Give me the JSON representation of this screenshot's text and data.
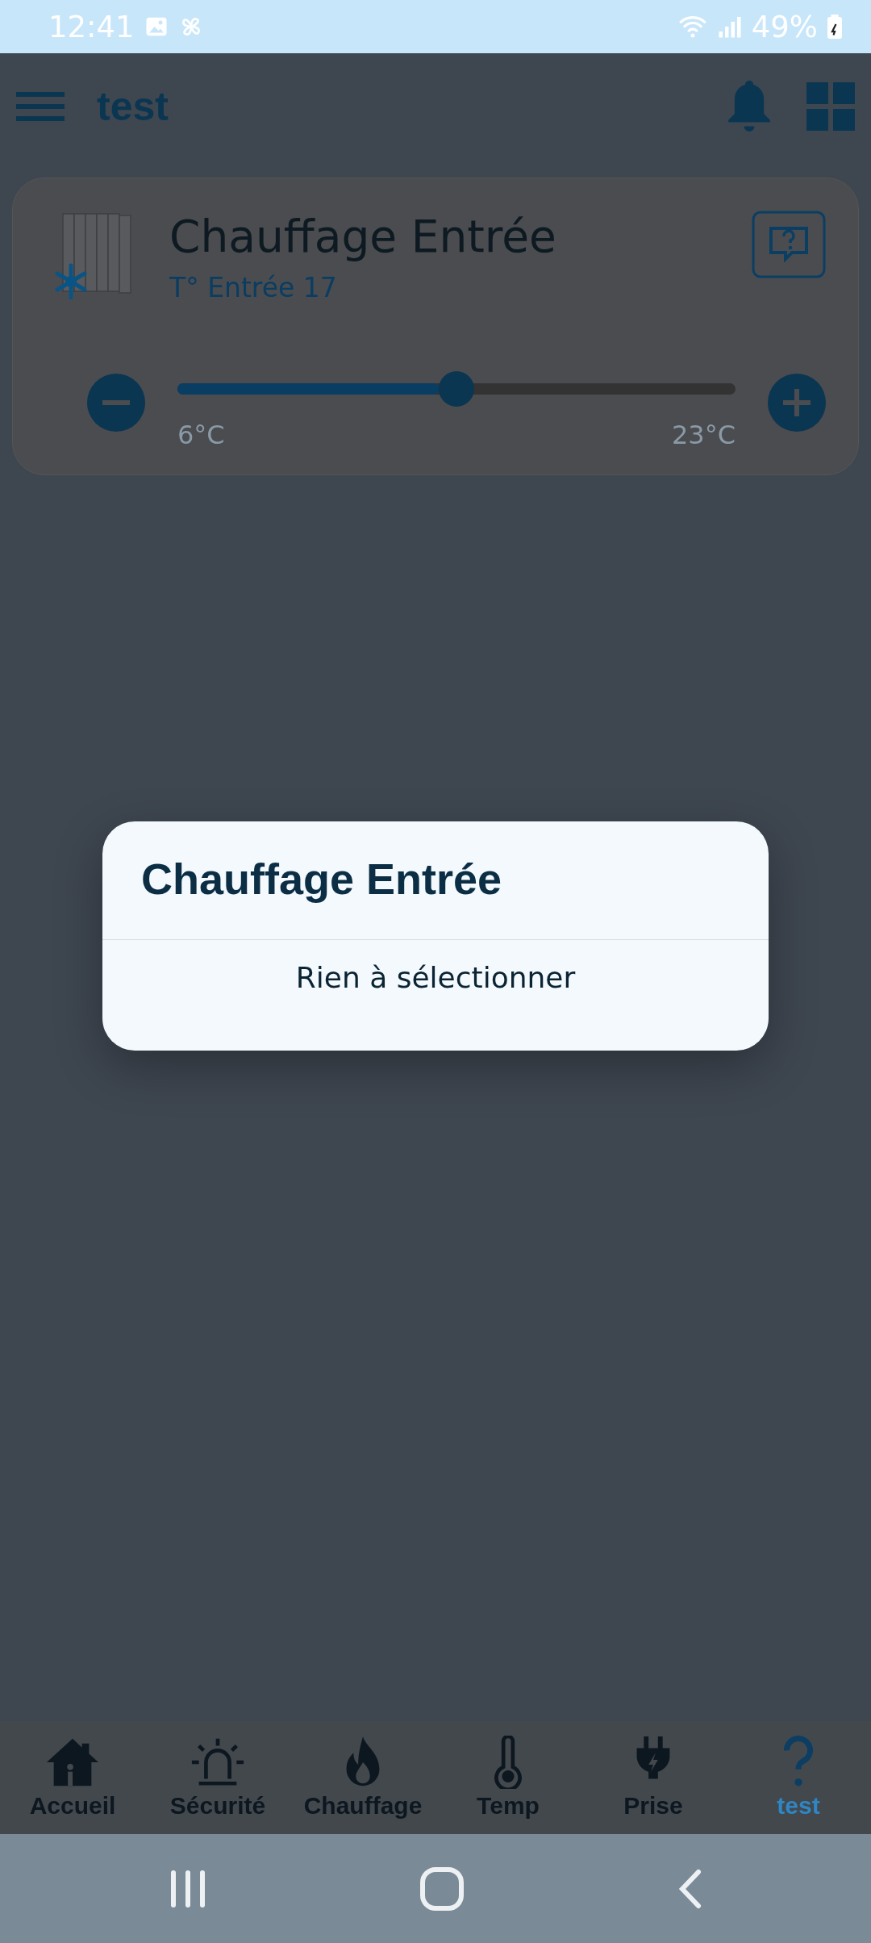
{
  "status_bar": {
    "time": "12:41",
    "battery": "49%"
  },
  "header": {
    "title": "test"
  },
  "card": {
    "title": "Chauffage Entrée",
    "subtitle": "T° Entrée 17",
    "slider": {
      "level": 0.47,
      "min_label": "6°C",
      "max_label": "23°C"
    }
  },
  "dialog": {
    "title": "Chauffage Entrée",
    "message": "Rien à sélectionner"
  },
  "bottom_nav": [
    {
      "kind": "home",
      "label": "Accueil",
      "selected": false
    },
    {
      "kind": "alarm",
      "label": "Sécurité",
      "selected": false
    },
    {
      "kind": "flame",
      "label": "Chauffage",
      "selected": false
    },
    {
      "kind": "thermometer",
      "label": "Temp",
      "selected": false
    },
    {
      "kind": "plug",
      "label": "Prise",
      "selected": false
    },
    {
      "kind": "question",
      "label": "test",
      "selected": true
    }
  ]
}
